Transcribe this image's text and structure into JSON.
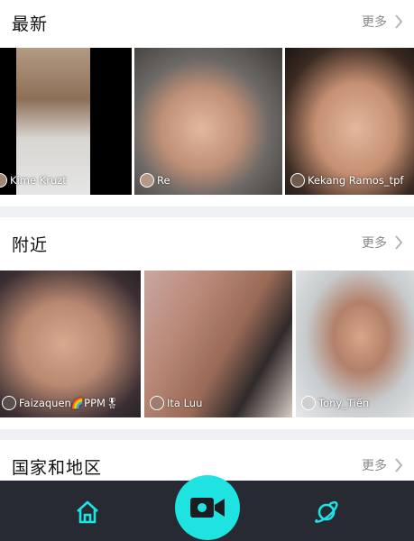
{
  "sections": [
    {
      "title": "最新",
      "more": "更多",
      "items": [
        {
          "name": "Kime Kruzt"
        },
        {
          "name": "Re"
        },
        {
          "name": "Kekang Ramos_tpf"
        }
      ]
    },
    {
      "title": "附近",
      "more": "更多",
      "items": [
        {
          "name": "Faizaquen🌈PPM🎖"
        },
        {
          "name": "Ita Luu"
        },
        {
          "name": "Tony_Tiến"
        }
      ]
    },
    {
      "title": "国家和地区",
      "more": "更多"
    }
  ],
  "tabbar": {
    "home_icon": "home-icon",
    "camera_icon": "video-camera-icon",
    "explore_icon": "planet-icon"
  },
  "colors": {
    "accent": "#1fe3e0",
    "tabbar_bg": "#272a32",
    "divider": "#eef0f3"
  }
}
